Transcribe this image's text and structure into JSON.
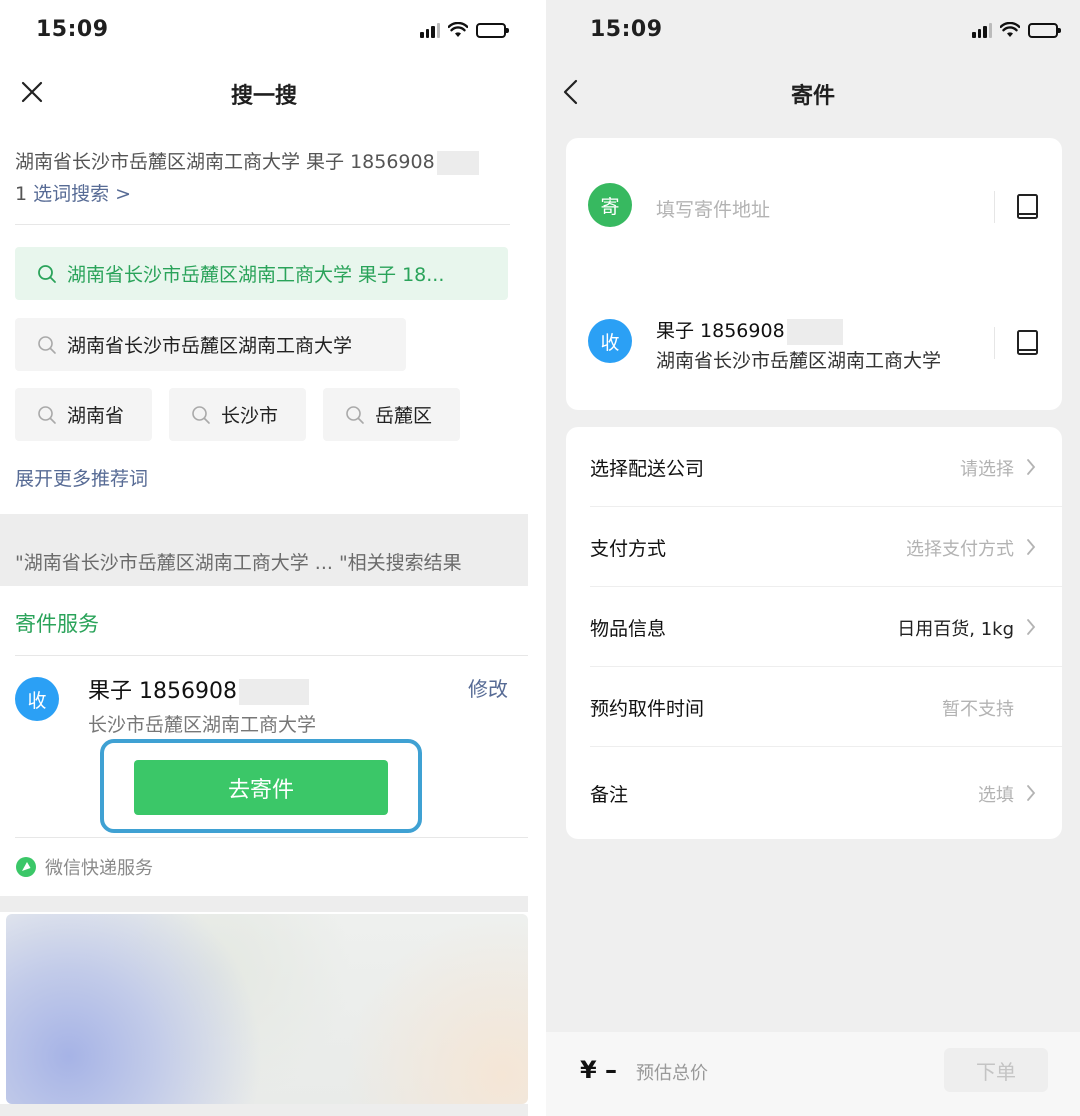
{
  "left": {
    "status_time": "15:09",
    "nav_title": "搜一搜",
    "query": {
      "text": "湖南省长沙市岳麓区湖南工商大学 果子 1856908",
      "link_prefix": "1 ",
      "link_text": "选词搜索 >"
    },
    "suggestions": [
      "湖南省长沙市岳麓区湖南工商大学 果子 18...",
      "湖南省长沙市岳麓区湖南工商大学",
      "湖南省",
      "长沙市",
      "岳麓区"
    ],
    "expand_more": "展开更多推荐词",
    "related_results": "\"湖南省长沙市岳麓区湖南工商大学 ... \"相关搜索结果",
    "service_title": "寄件服务",
    "receiver": {
      "badge": "收",
      "name": "果子 1856908",
      "address": "长沙市岳麓区湖南工商大学",
      "edit": "修改"
    },
    "send_button": "去寄件",
    "wechat_service": "微信快递服务"
  },
  "right": {
    "status_time": "15:09",
    "nav_title": "寄件",
    "sender": {
      "badge": "寄",
      "placeholder": "填写寄件地址"
    },
    "receiver": {
      "badge": "收",
      "name": "果子 1856908",
      "address": "湖南省长沙市岳麓区湖南工商大学"
    },
    "options": [
      {
        "label": "选择配送公司",
        "value": "请选择",
        "arrow": true
      },
      {
        "label": "支付方式",
        "value": "选择支付方式",
        "arrow": true
      },
      {
        "label": "物品信息",
        "value": "日用百货, 1kg",
        "arrow": true
      },
      {
        "label": "预约取件时间",
        "value": "暂不支持",
        "arrow": false
      },
      {
        "label": "备注",
        "value": "选填",
        "arrow": true
      }
    ],
    "footer": {
      "price": "¥ –",
      "price_note": "预估总价",
      "order_button": "下单"
    }
  },
  "colors": {
    "brand_green": "#3bc768",
    "link_blue": "#576b95",
    "badge_blue": "#2ba0f5",
    "highlight_frame": "#3fa1d3"
  }
}
